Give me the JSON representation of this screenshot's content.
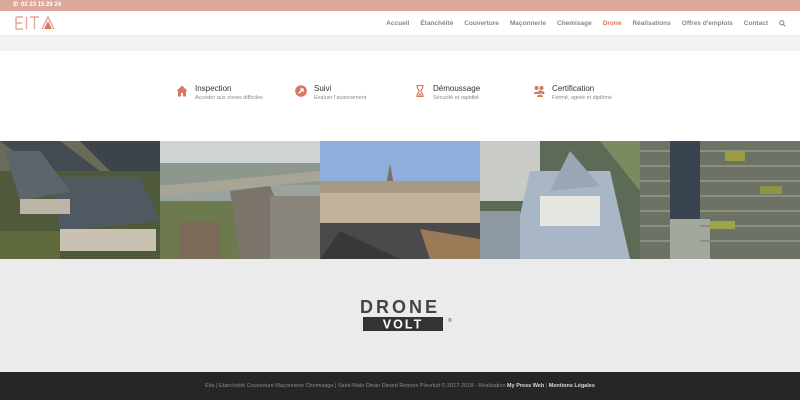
{
  "topbar": {
    "phone": "02 23 15 29 24"
  },
  "brand": {
    "logo_text": "EITA",
    "accent": "#d7785f"
  },
  "nav": {
    "items": [
      "Accueil",
      "Étanchéité",
      "Couverture",
      "Maçonnerie",
      "Chemisage",
      "Drone",
      "Réalisations",
      "Offres d'emplois",
      "Contact"
    ],
    "active": "Drone"
  },
  "features": [
    {
      "icon": "house-icon",
      "title": "Inspection",
      "subtitle": "Accéder aux zones difficiles"
    },
    {
      "icon": "arrow-up-right-icon",
      "title": "Suivi",
      "subtitle": "Evaluer l'avancement"
    },
    {
      "icon": "hourglass-icon",
      "title": "Démoussage",
      "subtitle": "Sécurité et rapidité"
    },
    {
      "icon": "group-icon",
      "title": "Certification",
      "subtitle": "Formé, agréé et diplômé"
    }
  ],
  "partner": {
    "line1": "DRONE",
    "line2": "VOLT",
    "mark": "®"
  },
  "footer": {
    "text": "Eita | Etanchéité Couverture Maçonnerie Chemisage | Saint-Malo Dinan Dinard Rennes Pleurtuit © 2017-2018 - Réalisation",
    "link1": "My Press Web",
    "separator": "|",
    "link2": "Mentions Légales"
  }
}
